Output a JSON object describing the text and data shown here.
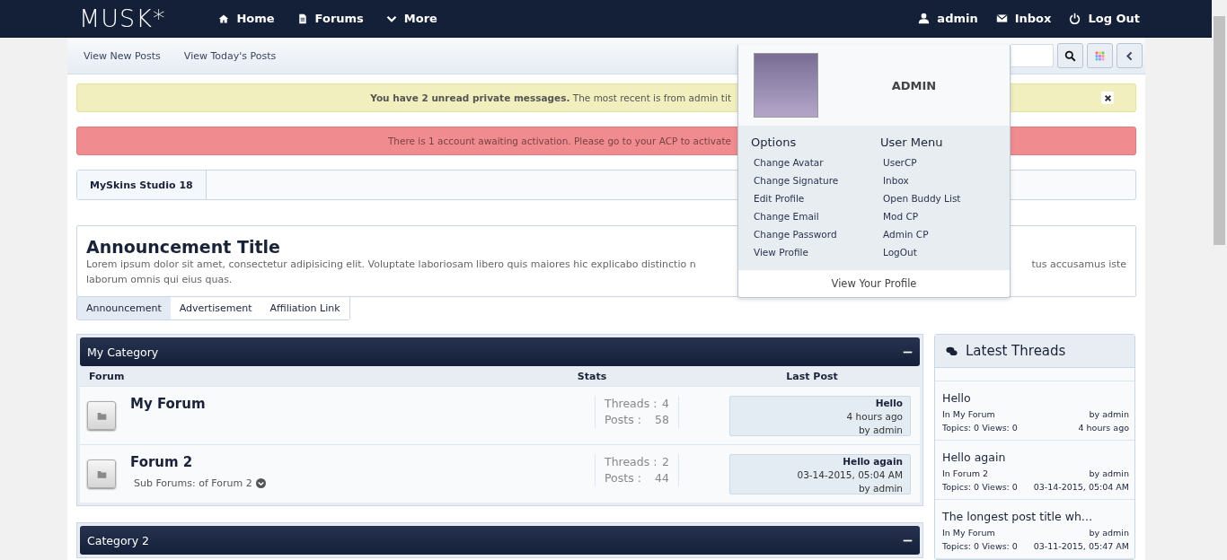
{
  "header": {
    "logo": "MUSK*",
    "nav": [
      {
        "label": "Home"
      },
      {
        "label": "Forums"
      },
      {
        "label": "More"
      }
    ],
    "user_links": [
      {
        "label": "admin"
      },
      {
        "label": "Inbox"
      },
      {
        "label": "Log Out"
      }
    ]
  },
  "subnav": {
    "links": [
      "View New Posts",
      "View Today's Posts"
    ]
  },
  "alerts": [
    {
      "kind": "notice",
      "text": "**You have 2 unread private messages.** The most recent is from admin tit",
      "dismissible": true
    },
    {
      "kind": "error",
      "text": "There is 1 account awaiting activation. Please go to your ACP to activate",
      "dismissible": false
    }
  ],
  "breadcrumb": [
    "MySkins Studio 18"
  ],
  "announcement": {
    "title": "Announcement Title",
    "body_left": "Lorem ipsum dolor sit amet, consectetur adipisicing elit. Voluptate laboriosam libero quis maiores hic explicabo distinctio n",
    "body_right": "tus accusamus iste",
    "body_line2": "laborum omnis qui eius quas.",
    "tabs": [
      {
        "label": "Announcement",
        "selected": true
      },
      {
        "label": "Advertisement",
        "selected": false
      },
      {
        "label": "Affiliation Link",
        "selected": false
      }
    ]
  },
  "categories": [
    {
      "title": "My Category",
      "expanded": true,
      "columns": [
        "Forum",
        "Stats",
        "Last Post"
      ],
      "forums": [
        {
          "name": "My Forum",
          "stats": [
            {
              "label": "Threads :",
              "value": "4"
            },
            {
              "label": "Posts :",
              "value": "58"
            }
          ],
          "last_post": {
            "title": "Hello",
            "time": "4 hours ago",
            "by": "by admin"
          }
        },
        {
          "name": "Forum 2",
          "subforums": "Sub Forums: of Forum 2",
          "stats": [
            {
              "label": "Threads :",
              "value": "2"
            },
            {
              "label": "Posts :",
              "value": "44"
            }
          ],
          "last_post": {
            "title": "Hello again",
            "time": "03-14-2015, 05:04 AM",
            "by": "by admin"
          }
        }
      ]
    },
    {
      "title": "Category 2",
      "expanded": true
    }
  ],
  "sidebar": {
    "title": "Latest Threads",
    "threads": [
      {
        "title": "Hello",
        "forum": "In My Forum",
        "by": "by admin",
        "counts": "Topics: 0 Views: 0",
        "time": "4 hours ago"
      },
      {
        "title": "Hello again",
        "forum": "In Forum 2",
        "by": "by admin",
        "counts": "Topics: 0 Views: 0",
        "time": "03-14-2015, 05:04 AM"
      },
      {
        "title": "The longest post title wh…",
        "forum": "In My Forum",
        "by": "by admin",
        "counts": "Topics: 0 Views: 0",
        "time": "03-11-2015, 05:47 AM"
      }
    ]
  },
  "user_menu": {
    "username": "ADMIN",
    "sections": [
      {
        "title": "Options",
        "items": [
          "Change Avatar",
          "Change Signature",
          "Edit Profile",
          "Change Email",
          "Change Password",
          "View Profile"
        ]
      },
      {
        "title": "User Menu",
        "items": [
          "UserCP",
          "Inbox",
          "Open Buddy List",
          "Mod CP",
          "Admin CP",
          "LogOut"
        ]
      }
    ],
    "footer": "View Your Profile"
  }
}
